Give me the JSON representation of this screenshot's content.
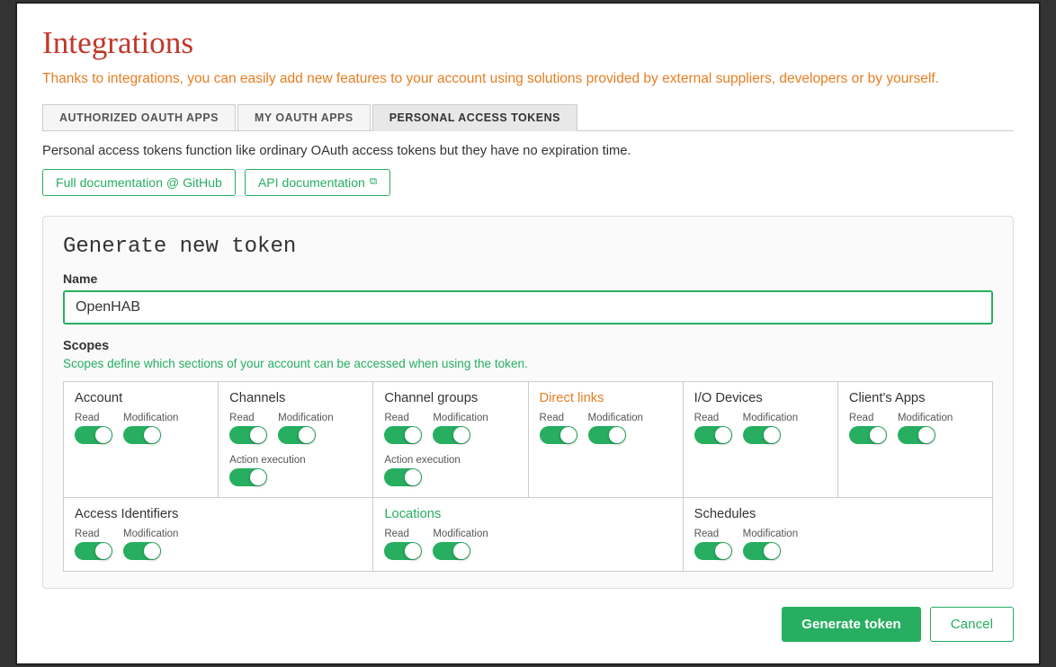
{
  "title": "Integrations",
  "subtitle": "Thanks to integrations, you can easily add new features to your account using solutions provided by external suppliers, developers or by yourself.",
  "tabs": [
    {
      "label": "AUTHORIZED OAUTH APPS",
      "active": false
    },
    {
      "label": "MY OAUTH APPS",
      "active": false
    },
    {
      "label": "PERSONAL ACCESS TOKENS",
      "active": true
    }
  ],
  "pat_description": "Personal access tokens function like ordinary OAuth access tokens but they have no expiration time.",
  "doc_links": [
    {
      "label": "Full documentation @ GitHub"
    },
    {
      "label": "API documentation",
      "external": true
    }
  ],
  "generate": {
    "title": "Generate new token",
    "name_label": "Name",
    "name_placeholder": "OpenHAB",
    "name_value": "OpenHAB",
    "scopes_title": "Scopes",
    "scopes_desc": "Scopes define which sections of your account can be accessed when using the token.",
    "scopes": [
      {
        "name": "Account",
        "name_color": "normal",
        "toggles": [
          {
            "label": "Read",
            "on": true
          },
          {
            "label": "Modification",
            "on": true
          }
        ]
      },
      {
        "name": "Channels",
        "name_color": "normal",
        "toggles": [
          {
            "label": "Read",
            "on": true
          },
          {
            "label": "Modification",
            "on": true
          },
          {
            "label": "Action execution",
            "on": true
          }
        ]
      },
      {
        "name": "Channel groups",
        "name_color": "normal",
        "toggles": [
          {
            "label": "Read",
            "on": true
          },
          {
            "label": "Modification",
            "on": true
          },
          {
            "label": "Action execution",
            "on": true
          }
        ]
      },
      {
        "name": "Direct links",
        "name_color": "orange",
        "toggles": [
          {
            "label": "Read",
            "on": true
          },
          {
            "label": "Modification",
            "on": true
          }
        ]
      },
      {
        "name": "I/O Devices",
        "name_color": "normal",
        "toggles": [
          {
            "label": "Read",
            "on": true
          },
          {
            "label": "Modification",
            "on": true
          }
        ]
      },
      {
        "name": "Client's Apps",
        "name_color": "normal",
        "toggles": [
          {
            "label": "Read",
            "on": true
          },
          {
            "label": "Modification",
            "on": true
          }
        ]
      }
    ],
    "scopes_row2": [
      {
        "name": "Access Identifiers",
        "name_color": "normal",
        "toggles": [
          {
            "label": "Read",
            "on": true
          },
          {
            "label": "Modification",
            "on": true
          }
        ]
      },
      {
        "name": "Locations",
        "name_color": "green",
        "toggles": [
          {
            "label": "Read",
            "on": true
          },
          {
            "label": "Modification",
            "on": true
          }
        ]
      },
      {
        "name": "Schedules",
        "name_color": "normal",
        "toggles": [
          {
            "label": "Read",
            "on": true
          },
          {
            "label": "Modification",
            "on": true
          }
        ]
      }
    ]
  },
  "buttons": {
    "generate_token": "Generate token",
    "cancel": "Cancel"
  }
}
